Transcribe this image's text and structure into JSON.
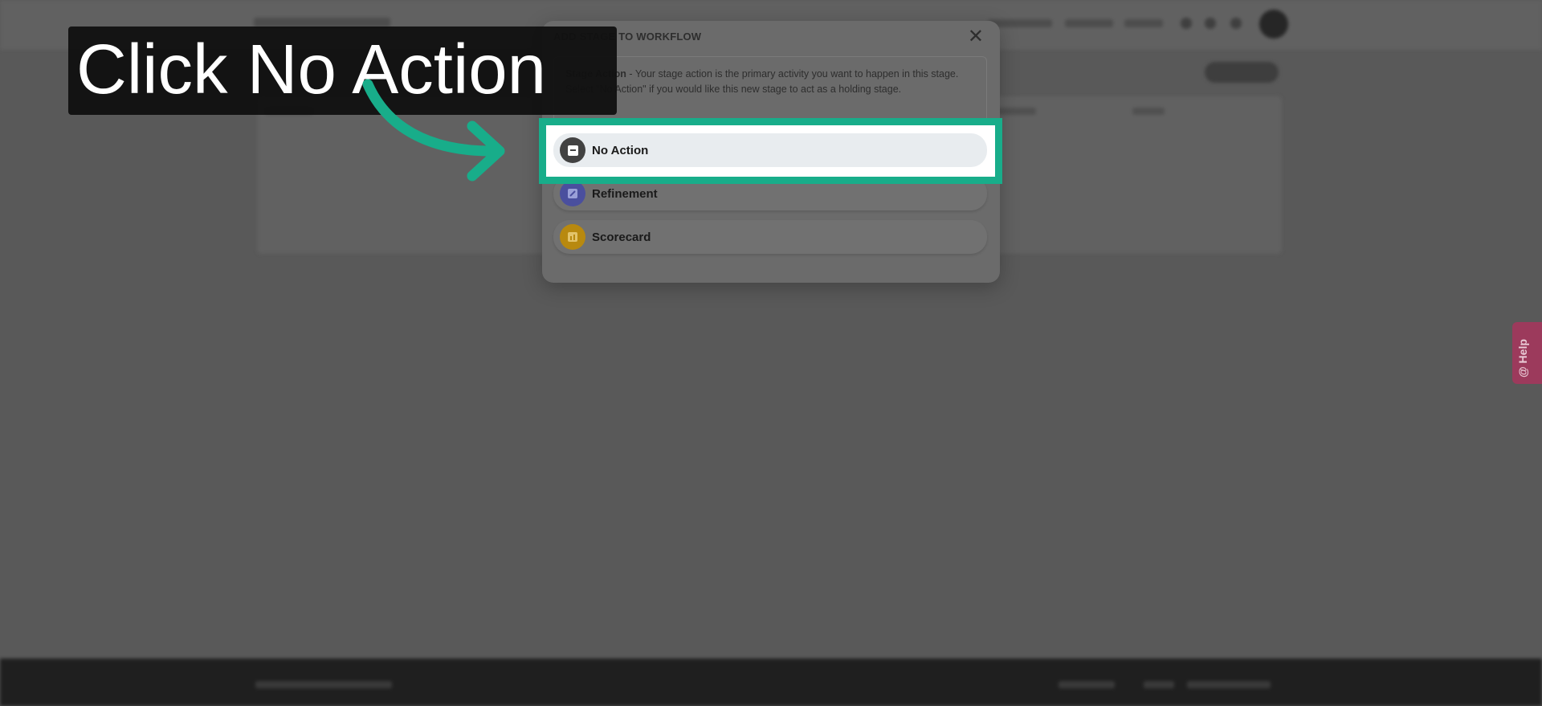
{
  "modal": {
    "title": "ADD STAGE TO WORKFLOW",
    "close_glyph": "✕",
    "description_bold": "Stage Action",
    "description_text": " - Your stage action is the primary activity you want to happen in this stage. Select \"No Action\" if you would like this new stage to act as a holding stage.",
    "options": [
      {
        "label": "No Action",
        "icon": "minus-square-icon",
        "color": "#424242"
      },
      {
        "label": "Refinement",
        "icon": "edit-icon",
        "color": "#4a4f9e"
      },
      {
        "label": "Scorecard",
        "icon": "bar-chart-icon",
        "color": "#b8890f"
      }
    ]
  },
  "callout": {
    "text": "Click No Action",
    "arrow_color": "#18ad8a"
  },
  "help": {
    "label": "Help",
    "icon": "at-icon"
  },
  "colors": {
    "highlight": "#18ad8a",
    "overlay": "#595959"
  }
}
